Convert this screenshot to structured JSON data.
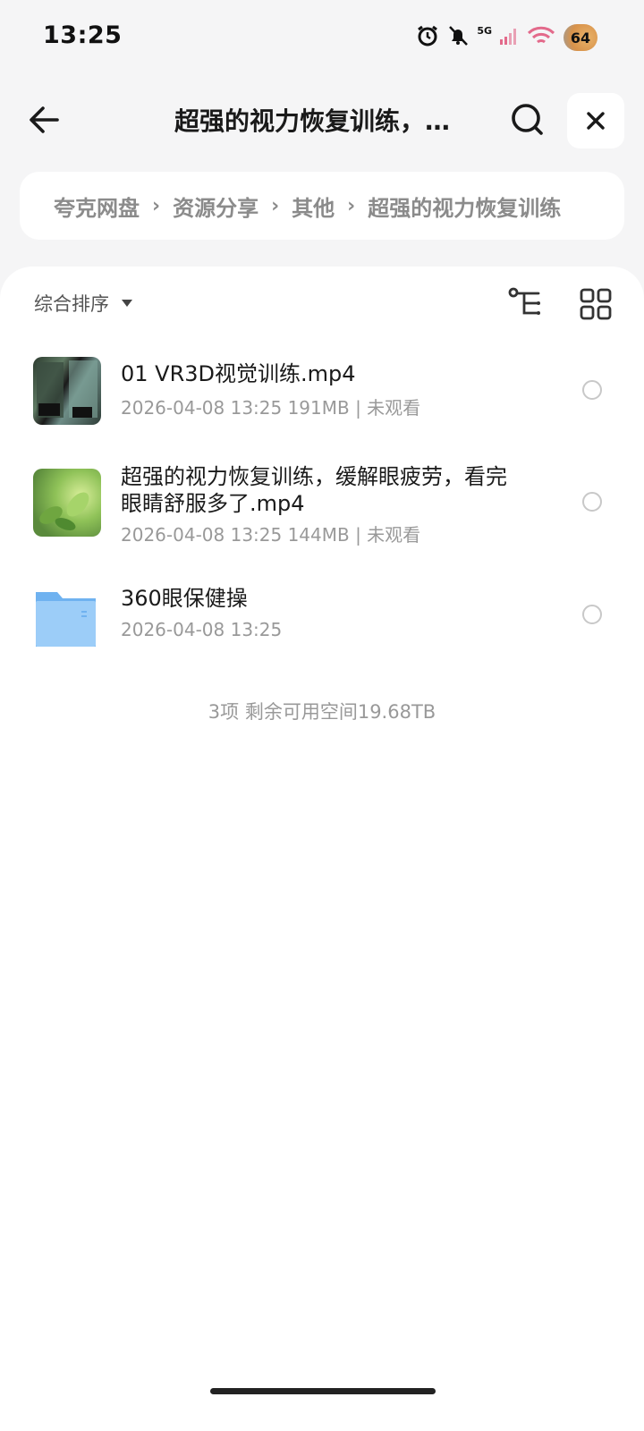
{
  "status_bar": {
    "time": "13:25",
    "network": "5G",
    "battery": "64",
    "icons": [
      "alarm-icon",
      "bell-off-icon",
      "signal-icon",
      "wifi-icon",
      "battery-icon"
    ]
  },
  "header": {
    "title": "超强的视力恢复训练，…",
    "icons": [
      "back-arrow-icon",
      "search-icon",
      "close-icon"
    ]
  },
  "breadcrumb": [
    "夸克网盘",
    "资源分享",
    "其他",
    "超强的视力恢复训练"
  ],
  "toolbar": {
    "sort_label": "综合排序",
    "icons": [
      "tree-view-icon",
      "grid-view-icon"
    ]
  },
  "files": [
    {
      "name": "01 VR3D视觉训练.mp4",
      "meta": "2026-04-08 13:25  191MB | 未观看",
      "type": "video"
    },
    {
      "name_line1": "超强的视力恢复训练，缓解眼疲劳，看完",
      "name_line2": "眼睛舒服多了.mp4",
      "meta": "2026-04-08 13:25  144MB | 未观看",
      "type": "video"
    },
    {
      "name": "360眼保健操",
      "meta": "2026-04-08 13:25",
      "type": "folder"
    }
  ],
  "footer": "3项 剩余可用空间19.68TB",
  "colors": {
    "folder": "#6fb2f0",
    "accent": "#1a1a1a",
    "muted": "#999999"
  }
}
